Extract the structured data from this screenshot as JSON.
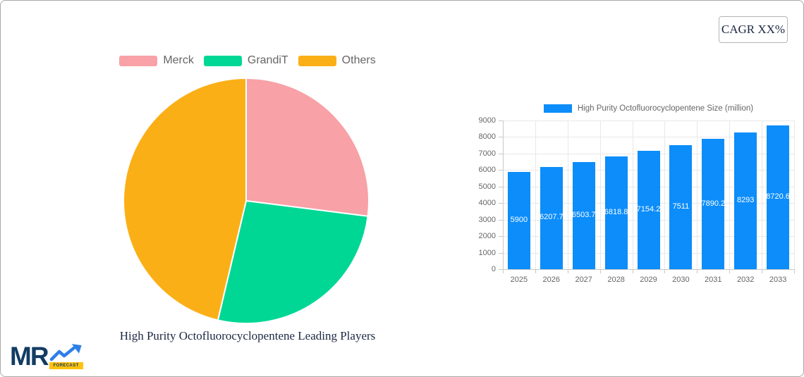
{
  "badges": {
    "cagr": "CAGR XX%"
  },
  "logo": {
    "mr": "MR",
    "forecast": "FORECAST"
  },
  "colors": {
    "bar_blue": "#0c8dfa",
    "grid": "#e8e8e8",
    "axis_line": "#c9c9c9",
    "axis_text": "#666666",
    "legend_text": "#666666",
    "title_text": "#1b2742",
    "border": "#a8a8a8"
  },
  "chart_data": [
    {
      "type": "pie",
      "title": "High Purity Octofluorocyclopentene Leading Players",
      "labels": [
        "Merck",
        "GrandiT",
        "Others"
      ],
      "values": [
        27.0,
        26.7,
        46.3
      ],
      "colors": [
        "#f8a1a6",
        "#00d795",
        "#fbaf17"
      ],
      "legend_position": "top",
      "start_angle_deg": 0,
      "slice_border_color": "#ffffff"
    },
    {
      "type": "bar",
      "legend_label": "High Purity Octofluorocyclopentene Size (million)",
      "categories": [
        "2025",
        "2026",
        "2027",
        "2028",
        "2029",
        "2030",
        "2031",
        "2032",
        "2033"
      ],
      "values": [
        5900,
        6207.7,
        6503.7,
        6818.8,
        7154.2,
        7511,
        7890.2,
        8293,
        8720.6
      ],
      "value_labels": [
        "5900",
        "6207.7",
        "6503.7",
        "6818.8",
        "7154.2",
        "7511",
        "7890.2",
        "8293",
        "8720.6"
      ],
      "bar_color": "#0c8dfa",
      "value_label_color": "#ffffff",
      "ylim": [
        0,
        9000
      ],
      "y_step": 1000,
      "grid": true,
      "legend_position": "top"
    }
  ]
}
